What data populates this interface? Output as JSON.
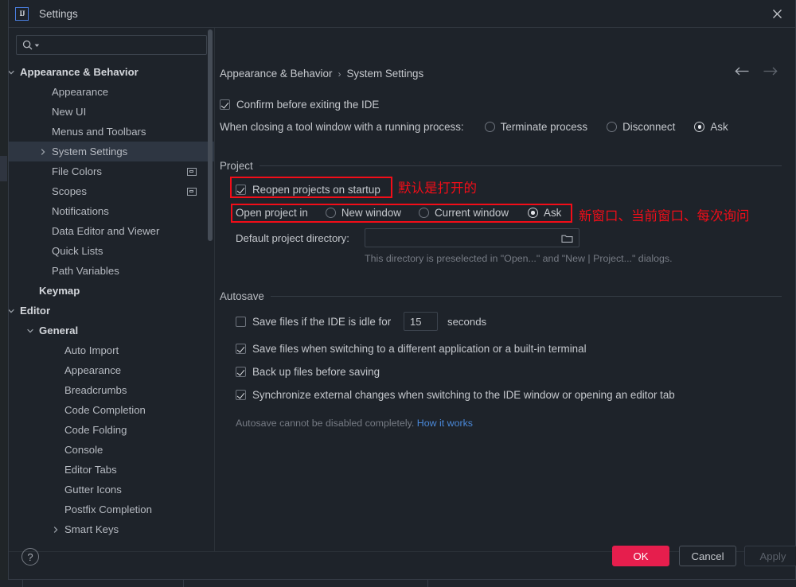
{
  "window": {
    "title": "Settings",
    "logo_icon": "intellij-idea-logo",
    "close_icon": "close-icon"
  },
  "sidebar": {
    "search": {
      "placeholder": "",
      "value": "",
      "icon": "search-icon",
      "dropdown_icon": "chevron-down-small-icon"
    },
    "scrollbar": "vertical-scrollbar",
    "items": [
      {
        "label": "Appearance & Behavior",
        "indent": 14,
        "arrow": "expanded",
        "bold": true,
        "selected": false,
        "badge": false
      },
      {
        "label": "Appearance",
        "indent": 54,
        "arrow": "none",
        "bold": false,
        "selected": false,
        "badge": false
      },
      {
        "label": "New UI",
        "indent": 54,
        "arrow": "none",
        "bold": false,
        "selected": false,
        "badge": false
      },
      {
        "label": "Menus and Toolbars",
        "indent": 54,
        "arrow": "none",
        "bold": false,
        "selected": false,
        "badge": false
      },
      {
        "label": "System Settings",
        "indent": 54,
        "arrow": "collapsed",
        "bold": false,
        "selected": true,
        "badge": false
      },
      {
        "label": "File Colors",
        "indent": 54,
        "arrow": "none",
        "bold": false,
        "selected": false,
        "badge": true
      },
      {
        "label": "Scopes",
        "indent": 54,
        "arrow": "none",
        "bold": false,
        "selected": false,
        "badge": true
      },
      {
        "label": "Notifications",
        "indent": 54,
        "arrow": "none",
        "bold": false,
        "selected": false,
        "badge": false
      },
      {
        "label": "Data Editor and Viewer",
        "indent": 54,
        "arrow": "none",
        "bold": false,
        "selected": false,
        "badge": false
      },
      {
        "label": "Quick Lists",
        "indent": 54,
        "arrow": "none",
        "bold": false,
        "selected": false,
        "badge": false
      },
      {
        "label": "Path Variables",
        "indent": 54,
        "arrow": "none",
        "bold": false,
        "selected": false,
        "badge": false
      },
      {
        "label": "Keymap",
        "indent": 38,
        "arrow": "none",
        "bold": true,
        "selected": false,
        "badge": false
      },
      {
        "label": "Editor",
        "indent": 14,
        "arrow": "expanded",
        "bold": true,
        "selected": false,
        "badge": false
      },
      {
        "label": "General",
        "indent": 38,
        "arrow": "expanded",
        "bold": true,
        "selected": false,
        "badge": false
      },
      {
        "label": "Auto Import",
        "indent": 70,
        "arrow": "none",
        "bold": false,
        "selected": false,
        "badge": false
      },
      {
        "label": "Appearance",
        "indent": 70,
        "arrow": "none",
        "bold": false,
        "selected": false,
        "badge": false
      },
      {
        "label": "Breadcrumbs",
        "indent": 70,
        "arrow": "none",
        "bold": false,
        "selected": false,
        "badge": false
      },
      {
        "label": "Code Completion",
        "indent": 70,
        "arrow": "none",
        "bold": false,
        "selected": false,
        "badge": false
      },
      {
        "label": "Code Folding",
        "indent": 70,
        "arrow": "none",
        "bold": false,
        "selected": false,
        "badge": false
      },
      {
        "label": "Console",
        "indent": 70,
        "arrow": "none",
        "bold": false,
        "selected": false,
        "badge": false
      },
      {
        "label": "Editor Tabs",
        "indent": 70,
        "arrow": "none",
        "bold": false,
        "selected": false,
        "badge": false
      },
      {
        "label": "Gutter Icons",
        "indent": 70,
        "arrow": "none",
        "bold": false,
        "selected": false,
        "badge": false
      },
      {
        "label": "Postfix Completion",
        "indent": 70,
        "arrow": "none",
        "bold": false,
        "selected": false,
        "badge": false
      },
      {
        "label": "Smart Keys",
        "indent": 70,
        "arrow": "collapsed",
        "bold": false,
        "selected": false,
        "badge": false
      }
    ]
  },
  "main": {
    "breadcrumb": {
      "parent": "Appearance & Behavior",
      "separator": "›",
      "current": "System Settings"
    },
    "nav": {
      "back_icon": "arrow-left-icon",
      "forward_icon": "arrow-right-icon"
    },
    "confirm_exit": {
      "label": "Confirm before exiting the IDE",
      "checked": true
    },
    "tool_window": {
      "label": "When closing a tool window with a running process:",
      "options": [
        {
          "label": "Terminate process",
          "selected": false
        },
        {
          "label": "Disconnect",
          "selected": false
        },
        {
          "label": "Ask",
          "selected": true
        }
      ]
    },
    "project_group": {
      "title": "Project",
      "reopen": {
        "label": "Reopen projects on startup",
        "checked": true
      },
      "open_project_in": {
        "label": "Open project in",
        "options": [
          {
            "label": "New window",
            "selected": false
          },
          {
            "label": "Current window",
            "selected": false
          },
          {
            "label": "Ask",
            "selected": true
          }
        ]
      },
      "default_dir": {
        "label": "Default project directory:",
        "value": "",
        "browse_icon": "folder-icon",
        "hint": "This directory is preselected in \"Open...\" and \"New | Project...\" dialogs."
      }
    },
    "autosave_group": {
      "title": "Autosave",
      "idle": {
        "label": "Save files if the IDE is idle for",
        "checked": false,
        "value": "15",
        "unit": "seconds"
      },
      "checkboxes": [
        {
          "label": "Save files when switching to a different application or a built-in terminal",
          "checked": true
        },
        {
          "label": "Back up files before saving",
          "checked": true
        },
        {
          "label": "Synchronize external changes when switching to the IDE window or opening an editor tab",
          "checked": true
        }
      ],
      "note": "Autosave cannot be disabled completely.",
      "note_link": "How it works"
    }
  },
  "annotations": {
    "color": "#f30d18",
    "note_reopen": "默认是打开的",
    "note_open_in": "新窗口、当前窗口、每次询问"
  },
  "footer": {
    "help_icon": "help-question-icon",
    "ok_label": "OK",
    "cancel_label": "Cancel",
    "apply_label": "Apply",
    "ok_color": "#e61e4d"
  }
}
